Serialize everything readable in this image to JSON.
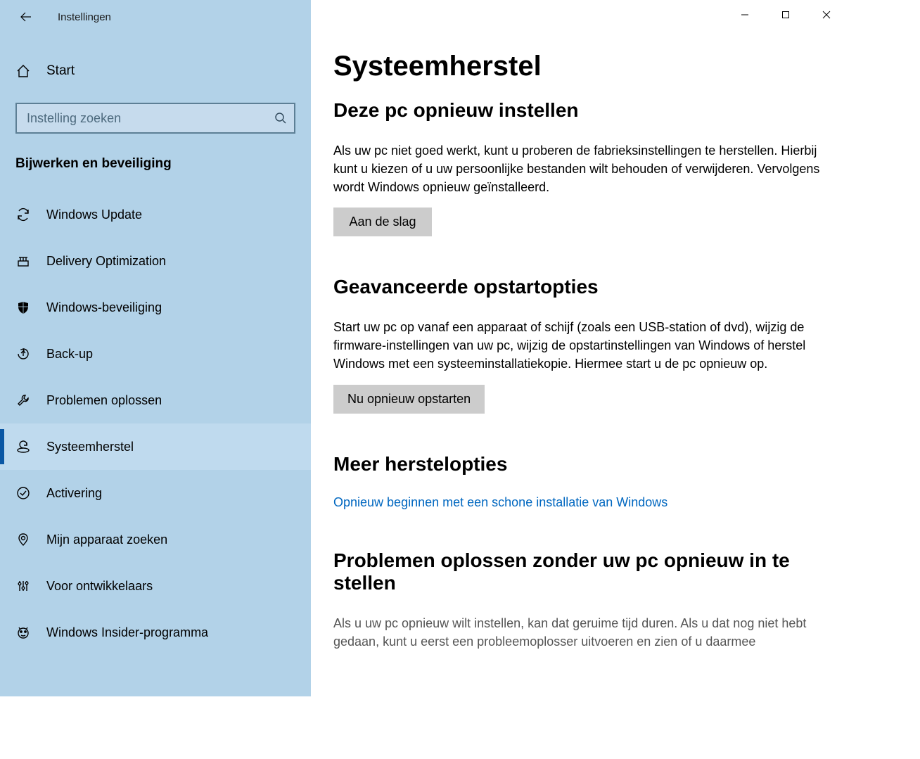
{
  "app_title": "Instellingen",
  "home_label": "Start",
  "search_placeholder": "Instelling zoeken",
  "category_title": "Bijwerken en beveiliging",
  "nav": [
    {
      "label": "Windows Update",
      "icon": "sync",
      "active": false
    },
    {
      "label": "Delivery Optimization",
      "icon": "delivery",
      "active": false
    },
    {
      "label": "Windows-beveiliging",
      "icon": "shield",
      "active": false
    },
    {
      "label": "Back-up",
      "icon": "backup",
      "active": false
    },
    {
      "label": "Problemen oplossen",
      "icon": "wrench",
      "active": false
    },
    {
      "label": "Systeemherstel",
      "icon": "recovery",
      "active": true
    },
    {
      "label": "Activering",
      "icon": "check-circle",
      "active": false
    },
    {
      "label": "Mijn apparaat zoeken",
      "icon": "find-device",
      "active": false
    },
    {
      "label": "Voor ontwikkelaars",
      "icon": "dev",
      "active": false
    },
    {
      "label": "Windows Insider-programma",
      "icon": "insider",
      "active": false
    }
  ],
  "page_title": "Systeemherstel",
  "sections": {
    "reset": {
      "heading": "Deze pc opnieuw instellen",
      "body": "Als uw pc niet goed werkt, kunt u proberen de fabrieksinstellingen te herstellen. Hierbij kunt u kiezen of u uw persoonlijke bestanden wilt behouden of verwijderen. Vervolgens wordt Windows opnieuw geïnstalleerd.",
      "button": "Aan de slag"
    },
    "advanced": {
      "heading": "Geavanceerde opstartopties",
      "body": "Start uw pc op vanaf een apparaat of schijf (zoals een USB-station of dvd), wijzig de firmware-instellingen van uw pc, wijzig de opstartinstellingen van Windows of herstel Windows met een systeeminstallatiekopie. Hiermee start u de pc opnieuw op.",
      "button": "Nu opnieuw opstarten"
    },
    "more": {
      "heading": "Meer herstelopties",
      "link": "Opnieuw beginnen met een schone installatie van Windows"
    },
    "troubleshoot": {
      "heading": "Problemen oplossen zonder uw pc opnieuw in te stellen",
      "body": "Als u uw pc opnieuw wilt instellen, kan dat geruime tijd duren. Als u dat nog niet hebt gedaan, kunt u eerst een probleemoplosser uitvoeren en zien of u daarmee"
    }
  }
}
